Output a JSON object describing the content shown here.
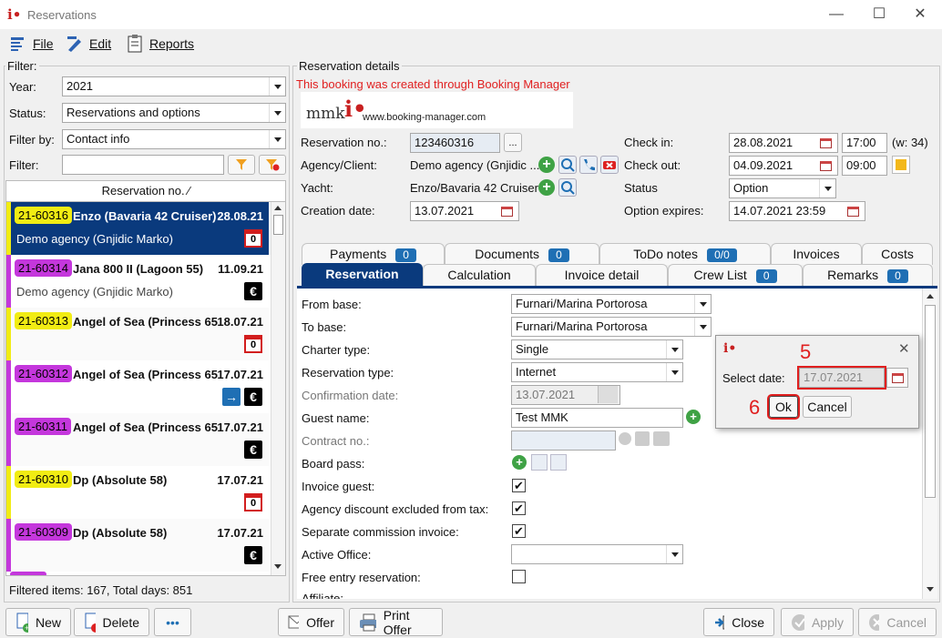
{
  "window": {
    "title": "Reservations"
  },
  "menu": {
    "file": "File",
    "edit": "Edit",
    "reports": "Reports"
  },
  "filter": {
    "title": "Filter:",
    "year_label": "Year:",
    "year_value": "2021",
    "status_label": "Status:",
    "status_value": "Reservations and options",
    "filterby_label": "Filter by:",
    "filterby_value": "Contact info",
    "filter_label": "Filter:",
    "filter_value": "",
    "list_header": "Reservation no. ⁄",
    "footer": "Filtered items: 167,  Total days: 851"
  },
  "reservations": [
    {
      "no": "21-60316",
      "yacht": "Enzo (Bavaria 42 Cruiser)",
      "date": "28.08.21",
      "agency": "Demo agency (Gnjidic Marko)",
      "cal": "0"
    },
    {
      "no": "21-60314",
      "yacht": "Jana 800 II (Lagoon 55)",
      "date": "11.09.21",
      "agency": "Demo agency (Gnjidic Marko)"
    },
    {
      "no": "21-60313",
      "yacht": "Angel of Sea (Princess 65",
      "date": "18.07.21",
      "cal": "0"
    },
    {
      "no": "21-60312",
      "yacht": "Angel of Sea (Princess 65",
      "date": "17.07.21"
    },
    {
      "no": "21-60311",
      "yacht": "Angel of Sea (Princess 65",
      "date": "17.07.21"
    },
    {
      "no": "21-60310",
      "yacht": "Dp (Absolute 58)",
      "date": "17.07.21",
      "cal": "0"
    },
    {
      "no": "21-60309",
      "yacht": "Dp (Absolute 58)",
      "date": "17.07.21"
    }
  ],
  "details": {
    "title": "Reservation details",
    "notice": "This booking was created through Booking Manager",
    "logo_text": "mmk",
    "logo_url": "www.booking-manager.com",
    "resno_label": "Reservation no.:",
    "resno_value": "123460316",
    "dots": "...",
    "agency_label": "Agency/Client:",
    "agency_value": "Demo agency (Gnjidic ...",
    "yacht_label": "Yacht:",
    "yacht_value": "Enzo/Bavaria 42 Cruiser",
    "creation_label": "Creation date:",
    "creation_value": "13.07.2021",
    "checkin_label": "Check in:",
    "checkin_date": "28.08.2021",
    "checkin_time": "17:00",
    "week": "(w: 34)",
    "checkout_label": "Check out:",
    "checkout_date": "04.09.2021",
    "checkout_time": "09:00",
    "status_label": "Status",
    "status_value": "Option",
    "expires_label": "Option expires:",
    "expires_value": "14.07.2021 23:59"
  },
  "tabs_top": [
    {
      "label": "Payments",
      "badge": "0"
    },
    {
      "label": "Documents",
      "badge": "0"
    },
    {
      "label": "ToDo notes",
      "badge": "0/0"
    },
    {
      "label": "Invoices"
    },
    {
      "label": "Costs"
    }
  ],
  "tabs_bottom": [
    {
      "label": "Reservation"
    },
    {
      "label": "Calculation"
    },
    {
      "label": "Invoice detail"
    },
    {
      "label": "Crew List",
      "badge": "0"
    },
    {
      "label": "Remarks",
      "badge": "0"
    }
  ],
  "form": {
    "from_base_label": "From base:",
    "from_base": "Furnari/Marina Portorosa",
    "to_base_label": "To base:",
    "to_base": "Furnari/Marina Portorosa",
    "charter_type_label": "Charter type:",
    "charter_type": "Single",
    "res_type_label": "Reservation type:",
    "res_type": "Internet",
    "confirm_label": "Confirmation date:",
    "confirm_value": "13.07.2021",
    "guest_label": "Guest name:",
    "guest_value": "Test MMK",
    "contract_label": "Contract no.:",
    "boardpass_label": "Board pass:",
    "invoice_guest_label": "Invoice guest:",
    "agency_discount_label": "Agency discount excluded from tax:",
    "separate_comm_label": "Separate commission invoice:",
    "active_office_label": "Active Office:",
    "free_entry_label": "Free entry reservation:",
    "affiliate_label": "Affiliate:",
    "check_mark": "✔"
  },
  "dialog": {
    "select_date_label": "Select date:",
    "date_value": "17.07.2021",
    "ok": "Ok",
    "cancel": "Cancel",
    "close": "✕",
    "step5": "5",
    "step6": "6"
  },
  "buttons": {
    "new": "New",
    "delete": "Delete",
    "more": "•••",
    "offer": "Offer",
    "print_offer": "Print Offer",
    "close": "Close",
    "apply": "Apply",
    "cancel": "Cancel"
  },
  "colors": {
    "selected_row": "#0a3a7d",
    "yellow_tag": "#f1ec13",
    "purple_tag": "#c437dc",
    "badge_blue": "#1f6fb4",
    "annotation_red": "#e01f1f"
  }
}
